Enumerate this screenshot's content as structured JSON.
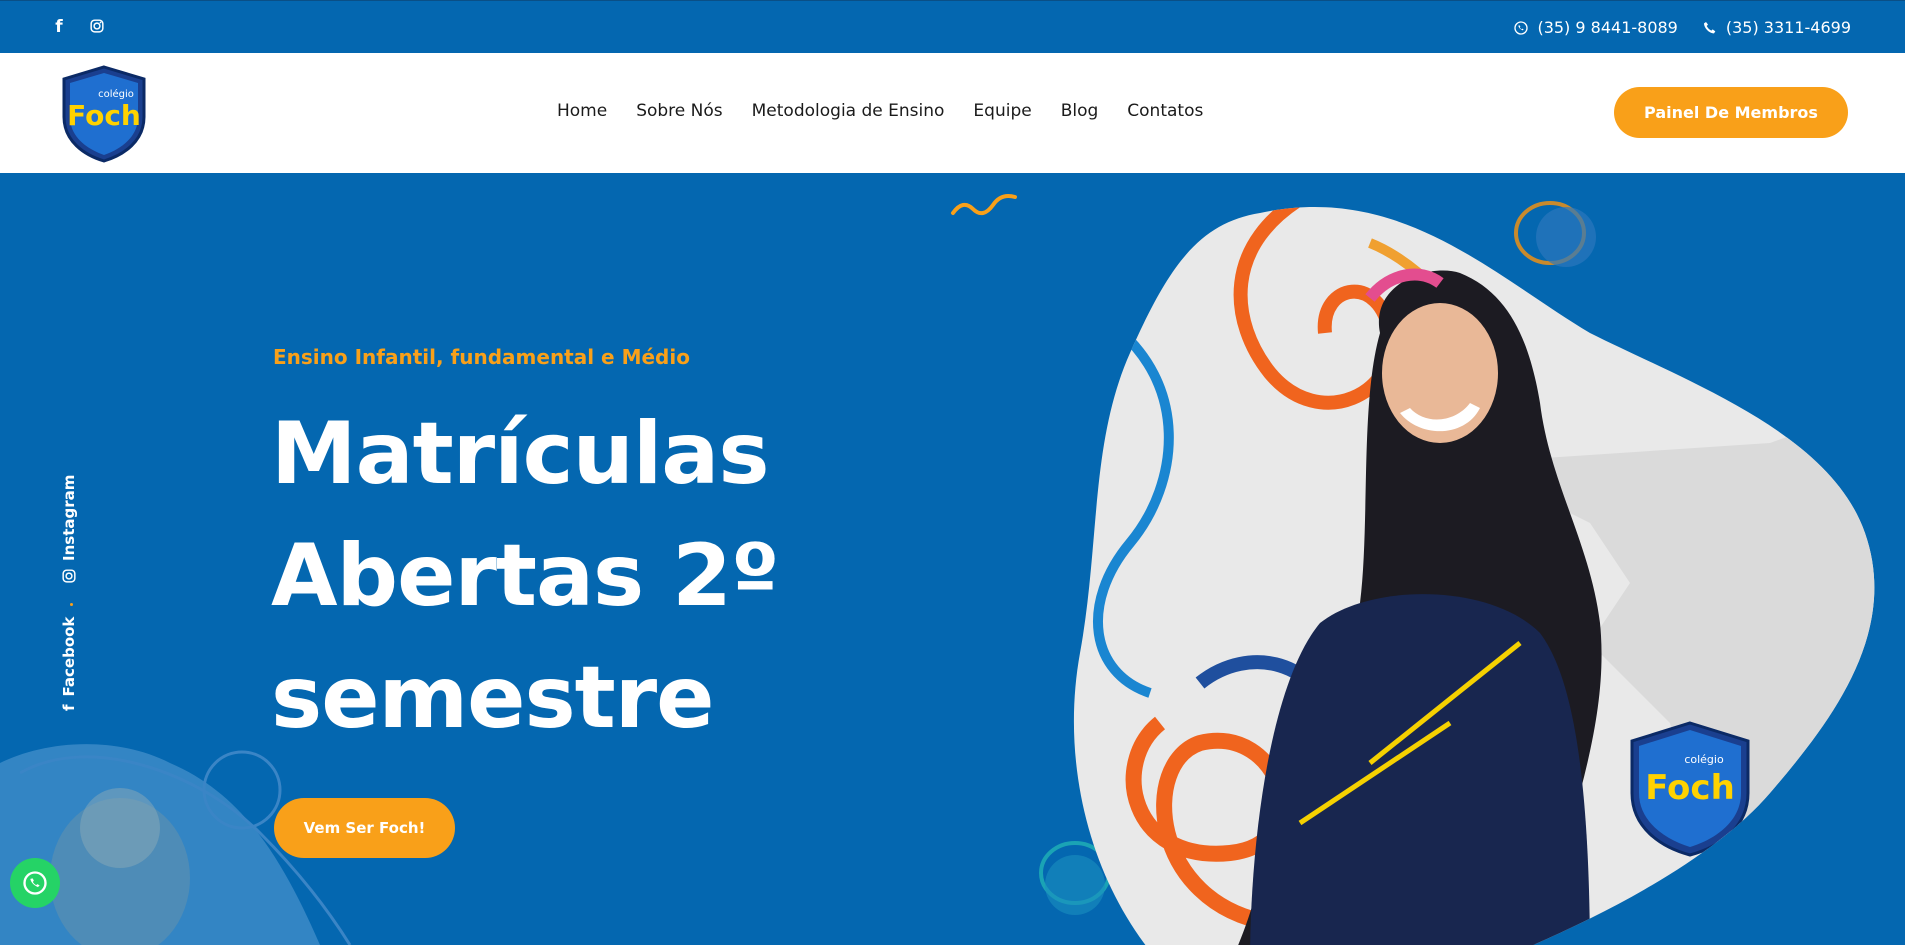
{
  "topbar": {
    "phone_whatsapp": "(35) 9 8441-8089",
    "phone_landline": "(35) 3311-4699"
  },
  "header": {
    "logo_text_small": "colégio",
    "logo_text_big": "Foch",
    "nav": [
      "Home",
      "Sobre Nós",
      "Metodologia de Ensino",
      "Equipe",
      "Blog",
      "Contatos"
    ],
    "member_button": "Painel De Membros"
  },
  "hero": {
    "subtitle": "Ensino Infantil, fundamental e Médio",
    "title_line1": "Matrículas",
    "title_line2": "Abertas 2º",
    "title_line3": "semestre",
    "cta": "Vem Ser Foch!",
    "social_facebook": "Facebook",
    "social_instagram": "Instagram"
  },
  "colors": {
    "brand_blue": "#0467b0",
    "accent_orange": "#f9a019",
    "whatsapp_green": "#25d366"
  },
  "icons": [
    "facebook-icon",
    "instagram-icon",
    "whatsapp-icon",
    "phone-icon"
  ]
}
